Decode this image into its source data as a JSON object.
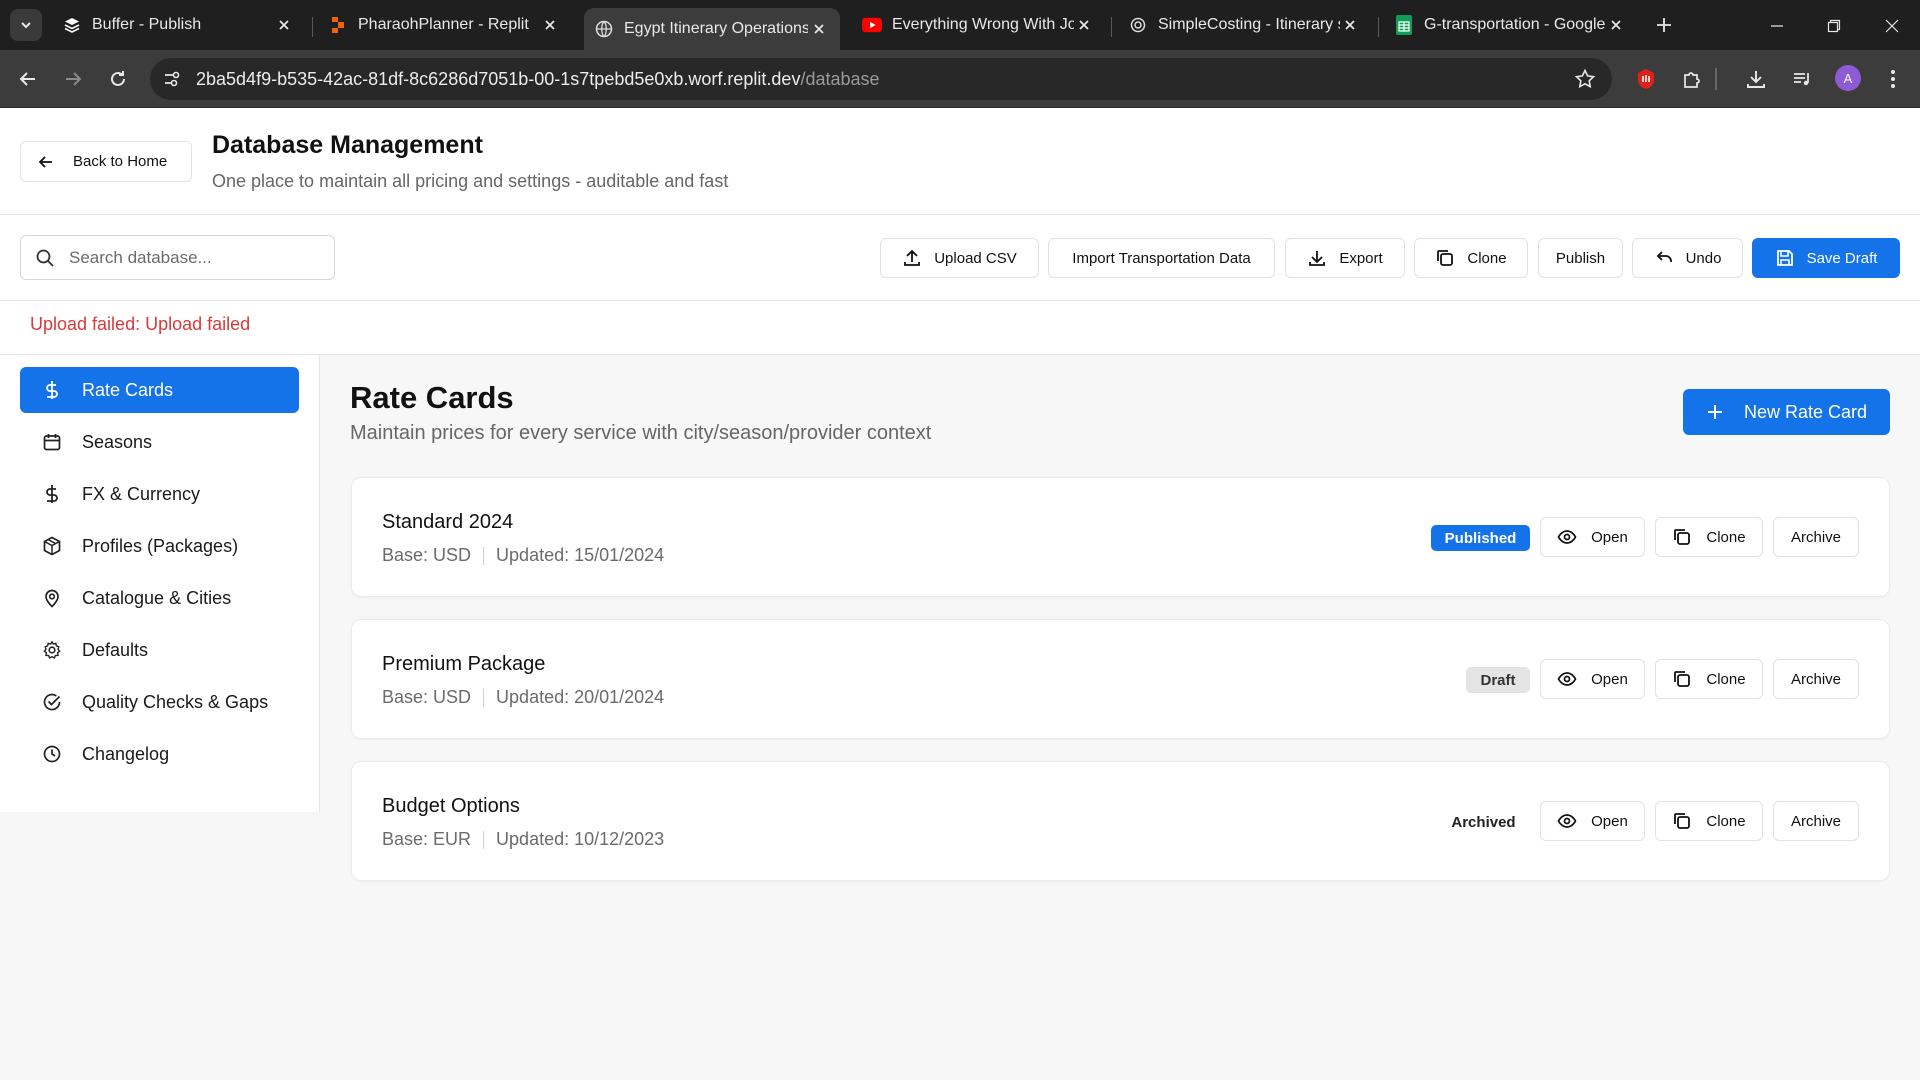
{
  "browser": {
    "tabs": [
      {
        "title": "Buffer - Publish",
        "icon": "buffer-icon"
      },
      {
        "title": "PharaohPlanner - Replit",
        "icon": "replit-icon"
      },
      {
        "title": "Egypt Itinerary Operations",
        "icon": "globe-icon",
        "active": true
      },
      {
        "title": "Everything Wrong With Jo",
        "icon": "youtube-icon"
      },
      {
        "title": "SimpleCosting - Itinerary s",
        "icon": "openai-icon"
      },
      {
        "title": "G-transportation - Google",
        "icon": "sheets-icon"
      }
    ],
    "url_host": "2ba5d4f9-b535-42ac-81df-8c6286d7051b-00-1s7tpebd5e0xb.worf.replit.dev",
    "url_path": "/database",
    "profile_initial": "A",
    "colors": {
      "youtube": "#ff0000",
      "replit": "#f26207",
      "sheets": "#0f9d58",
      "extension_red": "#e0211a"
    }
  },
  "header": {
    "back_label": "Back to Home",
    "title": "Database Management",
    "subtitle": "One place to maintain all pricing and settings - auditable and fast"
  },
  "actions": {
    "search_placeholder": "Search database...",
    "upload_csv": "Upload CSV",
    "import_transport": "Import Transportation Data",
    "export": "Export",
    "clone": "Clone",
    "publish": "Publish",
    "undo": "Undo",
    "save_draft": "Save Draft"
  },
  "error_message": "Upload failed: Upload failed",
  "sidebar": {
    "items": [
      {
        "label": "Rate Cards",
        "icon": "dollar-icon",
        "active": true
      },
      {
        "label": "Seasons",
        "icon": "calendar-icon"
      },
      {
        "label": "FX & Currency",
        "icon": "dollar-icon"
      },
      {
        "label": "Profiles (Packages)",
        "icon": "package-icon"
      },
      {
        "label": "Catalogue & Cities",
        "icon": "map-pin-icon"
      },
      {
        "label": "Defaults",
        "icon": "gear-icon"
      },
      {
        "label": "Quality Checks & Gaps",
        "icon": "check-circle-icon"
      },
      {
        "label": "Changelog",
        "icon": "clock-icon"
      }
    ]
  },
  "main": {
    "title": "Rate Cards",
    "subtitle": "Maintain prices for every service with city/season/provider context",
    "new_button": "New Rate Card",
    "cards": [
      {
        "name": "Standard 2024",
        "base": "Base: USD",
        "updated": "Updated: 15/01/2024",
        "status": "Published",
        "open": "Open",
        "clone": "Clone",
        "archive": "Archive"
      },
      {
        "name": "Premium Package",
        "base": "Base: USD",
        "updated": "Updated: 20/01/2024",
        "status": "Draft",
        "open": "Open",
        "clone": "Clone",
        "archive": "Archive"
      },
      {
        "name": "Budget Options",
        "base": "Base: EUR",
        "updated": "Updated: 10/12/2023",
        "status": "Archived",
        "open": "Open",
        "clone": "Clone",
        "archive": "Archive"
      }
    ]
  },
  "theme": {
    "accent": "#1573ea",
    "error": "#d63a3a"
  }
}
